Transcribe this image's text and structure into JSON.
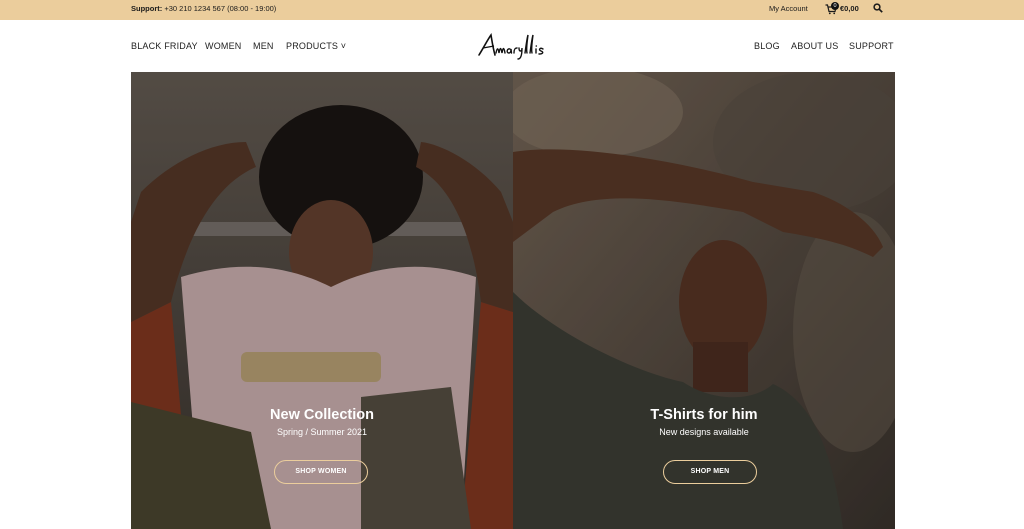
{
  "topbar": {
    "support_label": "Support:",
    "support_text": "+30 210 1234 567 (08:00 - 19:00)",
    "account_label": "My Account",
    "cart_count": "0",
    "cart_total": "€0,00",
    "background": "#ebcd9c"
  },
  "nav": {
    "left_items": [
      "BLACK FRIDAY",
      "WOMEN",
      "MEN",
      "PRODUCTS ˅"
    ],
    "right_items": [
      "BLOG",
      "ABOUT US",
      "SUPPORT"
    ],
    "logo_text": "Amaryllis"
  },
  "hero": {
    "left": {
      "title": "New Collection",
      "subtitle": "Spring / Summer 2021",
      "button": "SHOP WOMEN"
    },
    "right": {
      "title": "T-Shirts for him",
      "subtitle": "New designs available",
      "button": "SHOP MEN"
    },
    "button_border_color": "#ebcd9c"
  }
}
